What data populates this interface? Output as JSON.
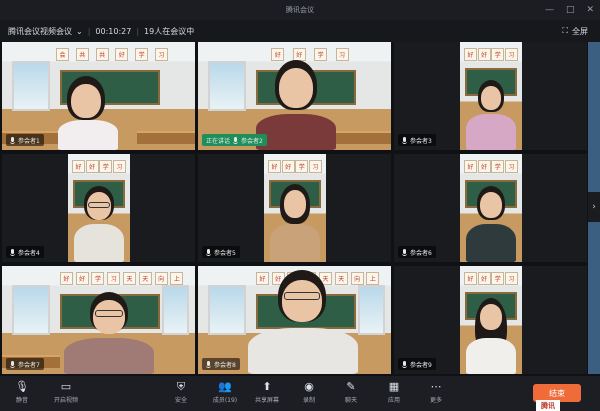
{
  "window": {
    "title": "腾讯会议",
    "controls": [
      "—",
      "□",
      "✕"
    ]
  },
  "meeting": {
    "title": "腾讯会议视频会议",
    "duration": "00:10:27",
    "participants": "19人在会议中",
    "layout_label": "全屏"
  },
  "tiles": [
    {
      "name": "参会者1",
      "speaking": false,
      "banner": [
        "会",
        "共",
        "共",
        "",
        "好",
        "学",
        "习"
      ]
    },
    {
      "name": "参会者2",
      "speaking": true,
      "speaker_tag": "正在讲话",
      "banner": [
        "好",
        "好",
        "学",
        "习"
      ]
    },
    {
      "name": "参会者3",
      "speaking": false,
      "banner": [
        "好",
        "好",
        "学",
        "习"
      ]
    },
    {
      "name": "参会者4",
      "speaking": false,
      "banner": [
        "好",
        "好",
        "学",
        "习"
      ]
    },
    {
      "name": "参会者5",
      "speaking": false,
      "banner": [
        "好",
        "好",
        "学",
        "习"
      ]
    },
    {
      "name": "参会者6",
      "speaking": false,
      "banner": [
        "好",
        "好",
        "学",
        "习"
      ]
    },
    {
      "name": "参会者7",
      "speaking": false,
      "banner": [
        "好",
        "好",
        "学",
        "习",
        "天",
        "天",
        "向",
        "上"
      ]
    },
    {
      "name": "参会者8",
      "speaking": false,
      "banner": [
        "好",
        "好",
        "学",
        "习",
        "天",
        "天",
        "向",
        "上"
      ]
    },
    {
      "name": "参会者9",
      "speaking": false,
      "banner": [
        "好",
        "好",
        "学",
        "习"
      ]
    }
  ],
  "toolbar": {
    "mute": "静音",
    "video": "开启视频",
    "security": "安全",
    "participants": "成员(19)",
    "share": "共享屏幕",
    "record": "录制",
    "chat": "聊天",
    "apps": "应用",
    "more": "更多",
    "end": "结束"
  },
  "corner_logo": "腾讯"
}
